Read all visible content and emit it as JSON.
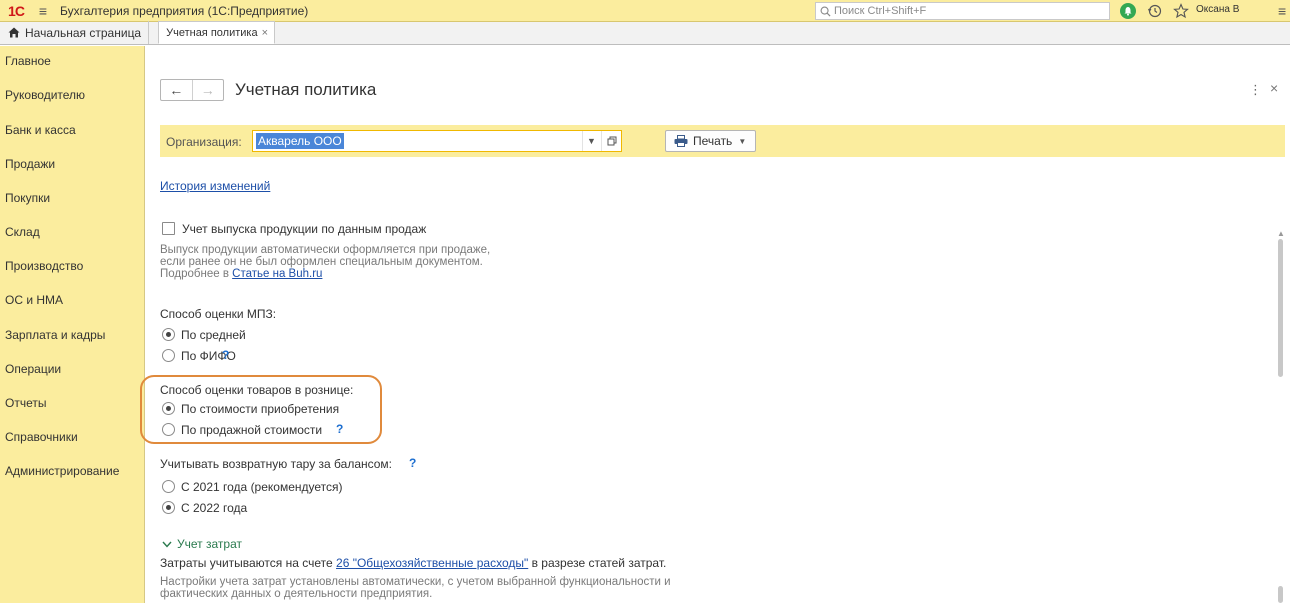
{
  "app": {
    "logo": "1С",
    "title": "Бухгалтерия предприятия (1С:Предприятие)",
    "search_placeholder": "Поиск Ctrl+Shift+F",
    "user": "Оксана В"
  },
  "tabs": {
    "home_label": "Начальная страница",
    "active_label": "Учетная политика",
    "close_symbol": "×"
  },
  "sidebar": {
    "items": [
      {
        "label": "Главное"
      },
      {
        "label": "Руководителю"
      },
      {
        "label": "Банк и касса"
      },
      {
        "label": "Продажи"
      },
      {
        "label": "Покупки"
      },
      {
        "label": "Склад"
      },
      {
        "label": "Производство"
      },
      {
        "label": "ОС и НМА"
      },
      {
        "label": "Зарплата и кадры"
      },
      {
        "label": "Операции"
      },
      {
        "label": "Отчеты"
      },
      {
        "label": "Справочники"
      },
      {
        "label": "Администрирование"
      }
    ]
  },
  "form": {
    "title": "Учетная политика",
    "org_label": "Организация:",
    "org_value": "Акварель ООО",
    "print_label": "Печать",
    "history_link": "История изменений"
  },
  "production": {
    "checkbox_label": "Учет выпуска продукции по данным продаж",
    "checked": false,
    "note_line1": "Выпуск продукции автоматически оформляется при продаже,",
    "note_line2": "если ранее он не был оформлен специальным документом.",
    "note_more_prefix": "Подробнее в",
    "note_more_link": "Статье на Buh.ru"
  },
  "mpz": {
    "label": "Способ оценки МПЗ:",
    "options": [
      "По средней",
      "По ФИФО"
    ],
    "selected": 0,
    "help": "?"
  },
  "retail": {
    "label": "Способ оценки товаров в рознице:",
    "options": [
      "По стоимости приобретения",
      "По продажной стоимости"
    ],
    "selected": 0,
    "help": "?"
  },
  "tara": {
    "label": "Учитывать возвратную тару за балансом:",
    "help": "?",
    "options": [
      "С 2021 года (рекомендуется)",
      "С 2022 года"
    ],
    "selected": 1
  },
  "costs": {
    "section_label": "Учет затрат",
    "text_prefix": "Затраты учитываются на счете",
    "text_link": "26 \"Общехозяйственные расходы\"",
    "text_suffix": "в разрезе статей затрат.",
    "note_line1": "Настройки учета затрат установлены автоматически, с учетом выбранной функциональности и",
    "note_line2": "фактических данных о деятельности предприятия."
  },
  "colors": {
    "topbar": "#fbed9e",
    "sidebar": "#fbed9e",
    "link": "#1d4fa8",
    "highlight": "#e08a3c",
    "help": "#1e6fd0",
    "section_green": "#2a7a4e"
  }
}
